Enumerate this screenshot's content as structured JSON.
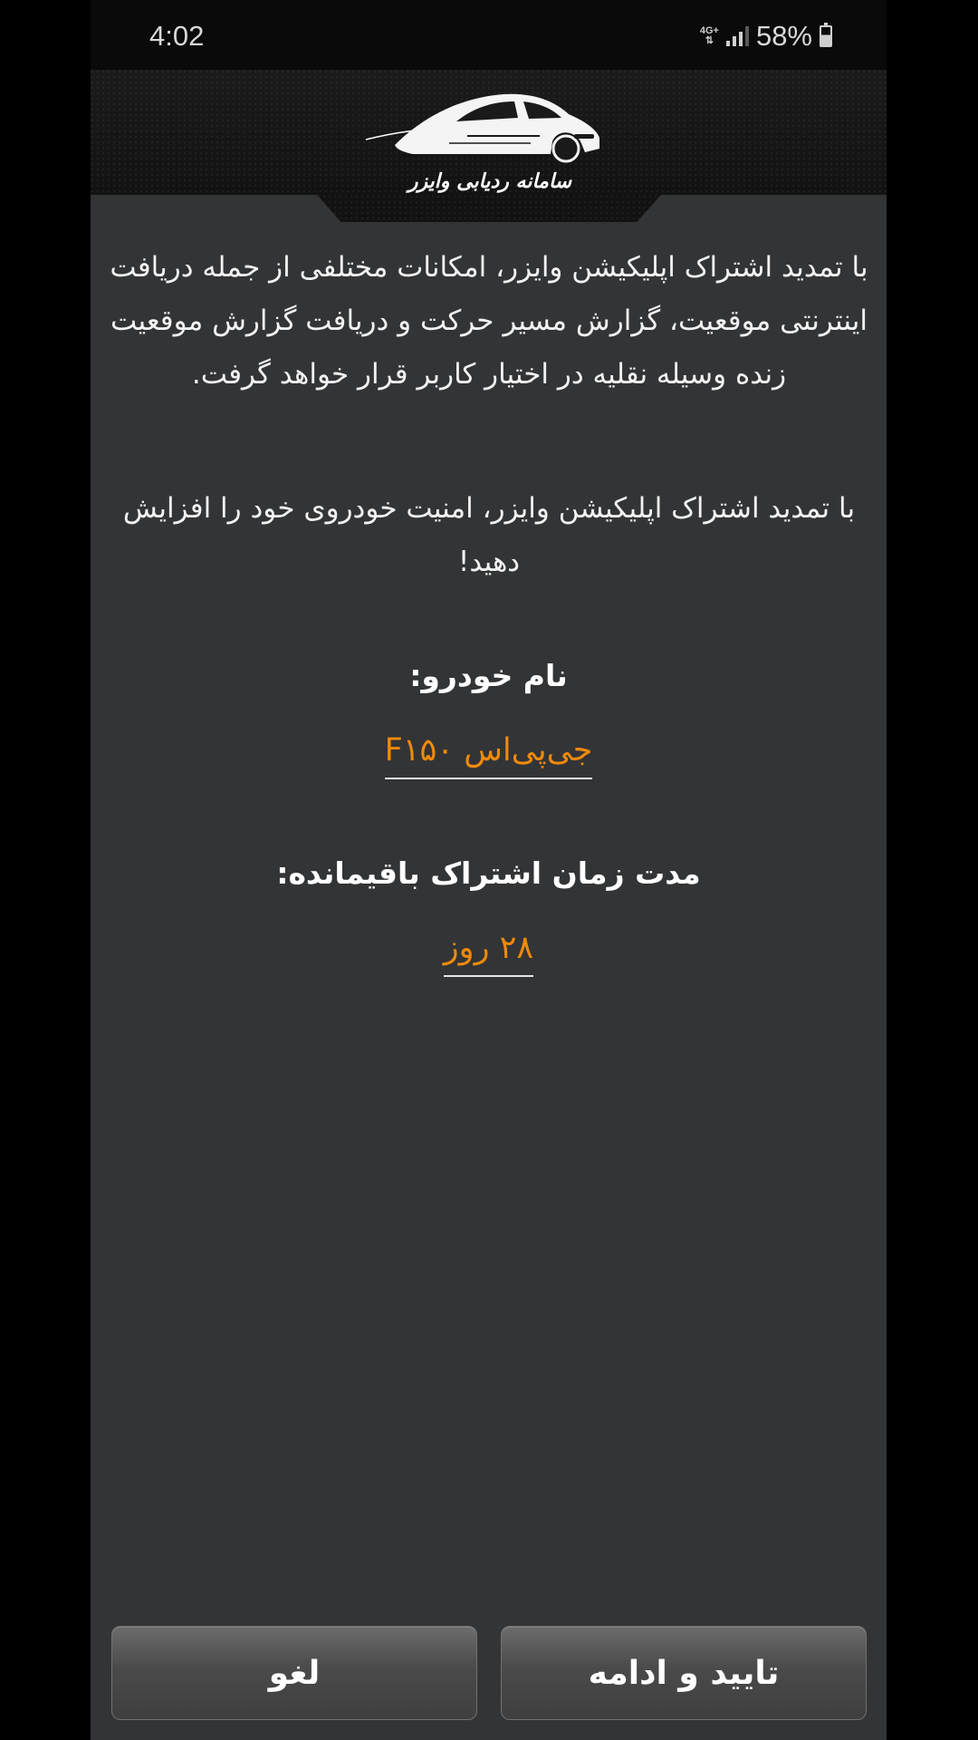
{
  "status_bar": {
    "time": "4:02",
    "network": "4G+",
    "battery": "58%"
  },
  "header": {
    "logo_text": "سامانه ردیابی وایزر",
    "icon": "car-logo-icon"
  },
  "content": {
    "paragraph1": "با تمدید اشتراک اپلیکیشن وایزر، امکانات مختلفی از جمله دریافت اینترنتی موقعیت، گزارش مسیر حرکت و دریافت گزارش موقعیت زنده وسیله نقلیه در اختیار کاربر قرار خواهد گرفت.",
    "paragraph2": "با تمدید اشتراک اپلیکیشن وایزر، امنیت خودروی خود را افزایش دهید!",
    "vehicle_label": "نام خودرو:",
    "vehicle_value": "جی‌پی‌اس F۱۵۰",
    "remaining_label": "مدت زمان اشتراک باقیمانده:",
    "remaining_value": "۲۸ روز"
  },
  "buttons": {
    "confirm": "تایید و ادامه",
    "cancel": "لغو"
  },
  "colors": {
    "background": "#333436",
    "accent": "#ef8a0c",
    "header": "#141414"
  }
}
